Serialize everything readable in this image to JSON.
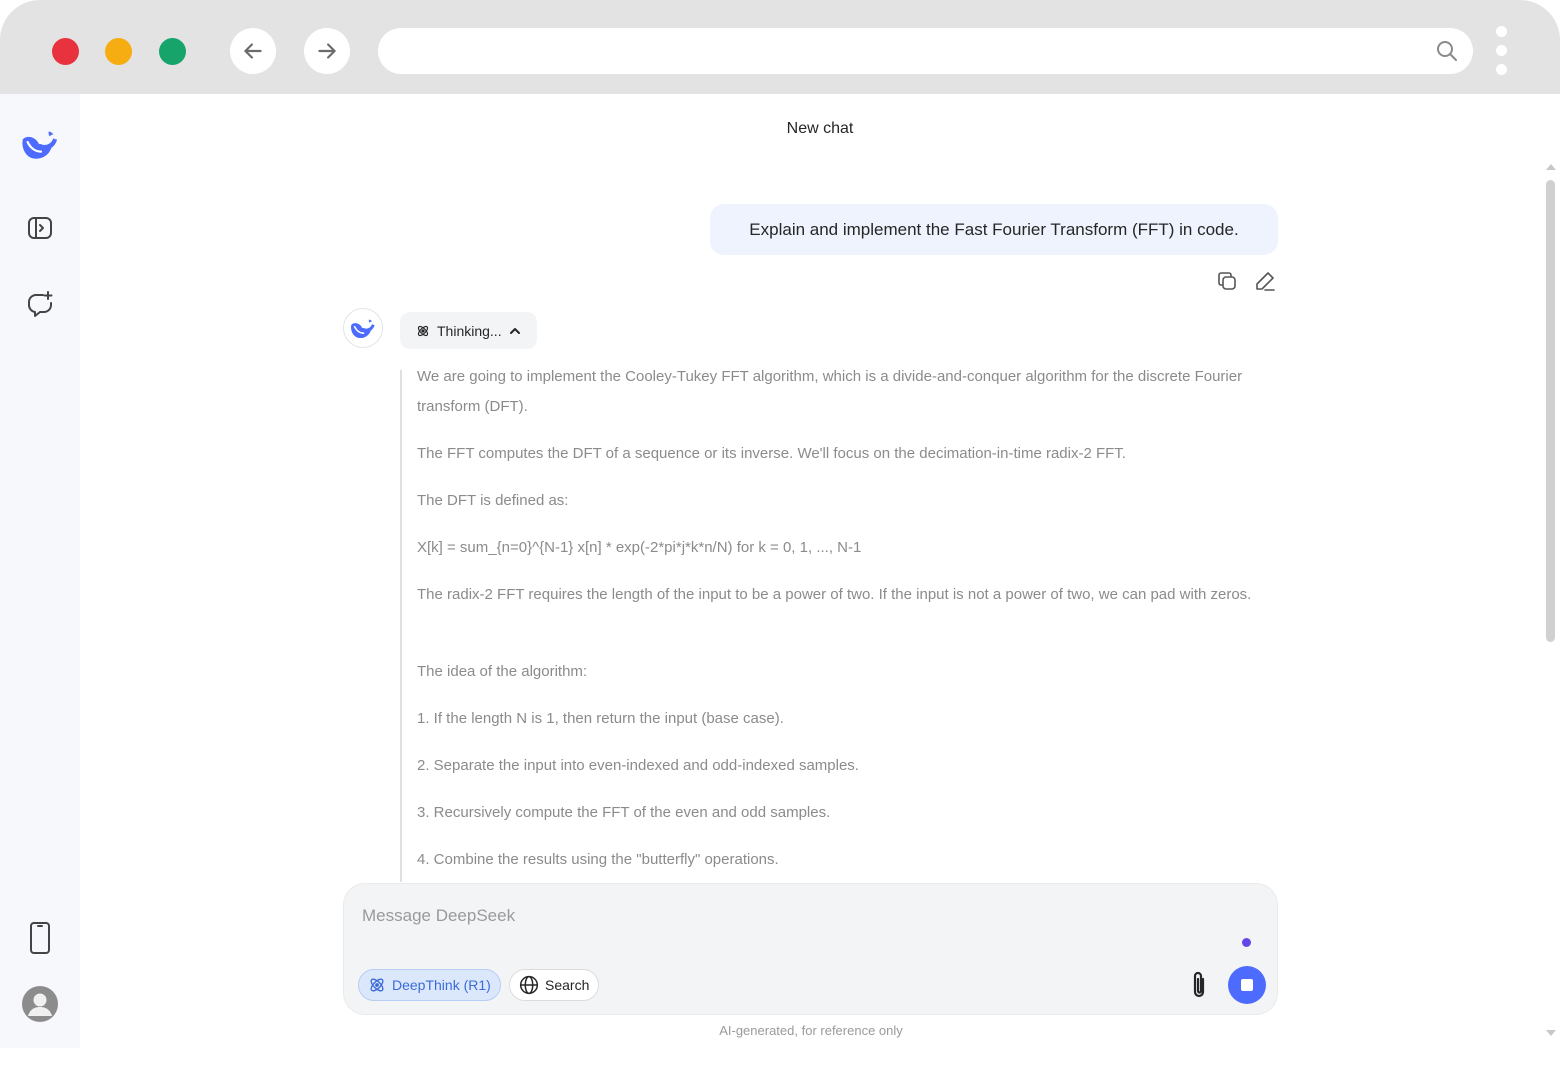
{
  "colors": {
    "accent": "#4d6bfe",
    "chrome_bg": "#e3e3e3",
    "sidebar_bg": "#f7f8fc",
    "user_bubble_bg": "#eef3fd",
    "thought_text": "#8b8b8b",
    "traffic_red": "#e8323e",
    "traffic_yellow": "#f6ad11",
    "traffic_green": "#16a46b"
  },
  "browser": {
    "url": "",
    "icons": [
      "back-arrow-icon",
      "forward-arrow-icon",
      "search-icon",
      "kebab-menu-icon"
    ]
  },
  "sidebar": {
    "items": [
      {
        "name": "deepseek-logo-icon"
      },
      {
        "name": "open-sidebar-icon"
      },
      {
        "name": "new-chat-icon"
      },
      {
        "name": "mobile-app-icon"
      },
      {
        "name": "user-avatar-icon"
      }
    ]
  },
  "header": {
    "title": "New chat"
  },
  "conversation": {
    "user_message": "Explain and implement the Fast Fourier Transform (FFT) in code.",
    "thinking_label": "Thinking...",
    "thought_paragraphs": [
      "We are going to implement the Cooley-Tukey FFT algorithm, which is a divide-and-conquer algorithm for the discrete Fourier transform (DFT).",
      "The FFT computes the DFT of a sequence or its inverse. We'll focus on the decimation-in-time radix-2 FFT.",
      "The DFT is defined as:",
      "X[k] = sum_{n=0}^{N-1} x[n] * exp(-2*pi*j*k*n/N) for k = 0, 1, ..., N-1",
      "The radix-2 FFT requires the length of the input to be a power of two. If the input is not a power of two, we can pad with zeros.",
      "The idea of the algorithm:",
      "1. If the length N is 1, then return the input (base case).",
      "2. Separate the input into even-indexed and odd-indexed samples.",
      "3. Recursively compute the FFT of the even and odd samples.",
      "4. Combine the results using the \"butterfly\" operations."
    ]
  },
  "composer": {
    "placeholder": "Message DeepSeek",
    "value": "",
    "deepthink_label": "DeepThink (R1)",
    "search_label": "Search"
  },
  "footer": {
    "note": "AI-generated, for reference only"
  }
}
